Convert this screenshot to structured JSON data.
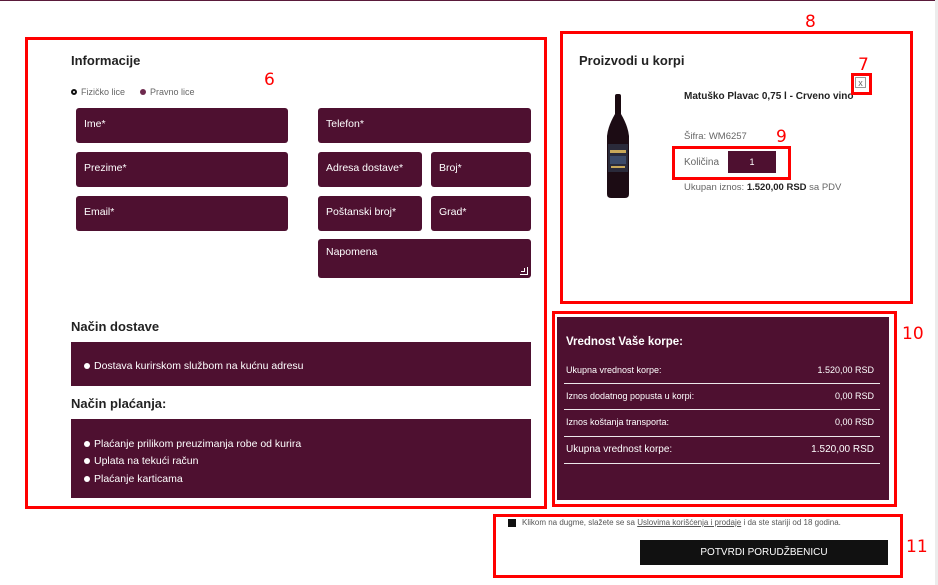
{
  "info": {
    "title": "Informacije",
    "person_types": [
      {
        "label": "Fizičko lice",
        "selected": true
      },
      {
        "label": "Pravno lice",
        "selected": false
      }
    ],
    "fields": {
      "ime": "Ime*",
      "prezime": "Prezime*",
      "email": "Email*",
      "telefon": "Telefon*",
      "adresa": "Adresa dostave*",
      "broj": "Broj*",
      "postanski": "Poštanski broj*",
      "grad": "Grad*",
      "napomena": "Napomena"
    }
  },
  "delivery": {
    "title": "Način dostave",
    "option": "Dostava kurirskom službom na kućnu adresu"
  },
  "payment": {
    "title": "Način plaćanja:",
    "options": [
      "Plaćanje prilikom preuzimanja robe od kurira",
      "Uplata na tekući račun",
      "Plaćanje karticama"
    ]
  },
  "cart": {
    "title": "Proizvodi u korpi",
    "remove_label": "x",
    "product_name": "Matuško Plavac 0,75 l - Crveno vino",
    "sku_label": "Šifra:",
    "sku": "WM6257",
    "qty_label": "Količina",
    "qty": "1",
    "total_label": "Ukupan iznos:",
    "total_value": "1.520,00 RSD",
    "total_suffix": "sa PDV"
  },
  "summary": {
    "title": "Vrednost Vaše korpe:",
    "rows": [
      {
        "label": "Ukupna vrednost korpe:",
        "value": "1.520,00 RSD"
      },
      {
        "label": "Iznos dodatnog popusta u korpi:",
        "value": "0,00 RSD"
      },
      {
        "label": "Iznos koštanja transporta:",
        "value": "0,00 RSD"
      },
      {
        "label": "Ukupna vrednost korpe:",
        "value": "1.520,00 RSD"
      }
    ]
  },
  "terms": {
    "prefix": "Klikom na dugme, slažete se sa",
    "link": "Uslovima korišćenja i prodaje",
    "suffix": "i da ste stariji od 18 godina."
  },
  "submit_label": "POTVRDI PORUDŽBENICU",
  "annotations": [
    "6",
    "7",
    "8",
    "9",
    "10",
    "11"
  ],
  "colors": {
    "accent": "#4e1030",
    "annotation": "#ff0000",
    "button": "#111111"
  }
}
